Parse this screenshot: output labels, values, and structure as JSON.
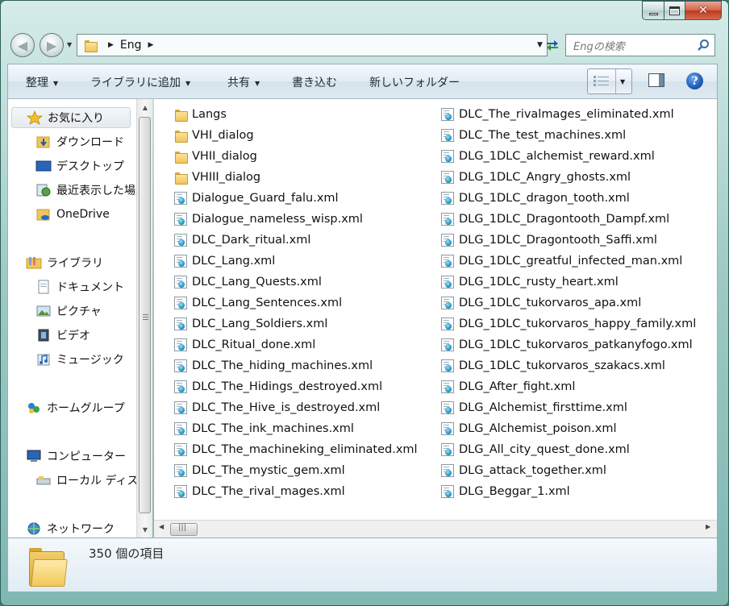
{
  "window": {
    "caption_buttons": {
      "minimize": "minimize",
      "maximize": "maximize",
      "close": "close"
    }
  },
  "address_bar": {
    "crumbs": [
      "Eng"
    ],
    "search_placeholder": "Engの検索"
  },
  "toolbar": {
    "organize": "整理",
    "add_to_library": "ライブラリに追加",
    "share": "共有",
    "burn": "書き込む",
    "new_folder": "新しいフォルダー"
  },
  "nav_pane": {
    "favorites": "お気に入り",
    "downloads": "ダウンロード",
    "desktop": "デスクトップ",
    "recent": "最近表示した場所",
    "onedrive": "OneDrive",
    "libraries": "ライブラリ",
    "documents": "ドキュメント",
    "pictures": "ピクチャ",
    "videos": "ビデオ",
    "music": "ミュージック",
    "homegroup": "ホームグループ",
    "computer": "コンピューター",
    "local_disk": "ローカル ディスク",
    "network": "ネットワーク"
  },
  "files": {
    "column1": [
      {
        "name": "Langs",
        "type": "folder"
      },
      {
        "name": "VHI_dialog",
        "type": "folder"
      },
      {
        "name": "VHII_dialog",
        "type": "folder"
      },
      {
        "name": "VHIII_dialog",
        "type": "folder"
      },
      {
        "name": "Dialogue_Guard_falu.xml",
        "type": "xml"
      },
      {
        "name": "Dialogue_nameless_wisp.xml",
        "type": "xml"
      },
      {
        "name": "DLC_Dark_ritual.xml",
        "type": "xml"
      },
      {
        "name": "DLC_Lang.xml",
        "type": "xml"
      },
      {
        "name": "DLC_Lang_Quests.xml",
        "type": "xml"
      },
      {
        "name": "DLC_Lang_Sentences.xml",
        "type": "xml"
      },
      {
        "name": "DLC_Lang_Soldiers.xml",
        "type": "xml"
      },
      {
        "name": "DLC_Ritual_done.xml",
        "type": "xml"
      },
      {
        "name": "DLC_The_hiding_machines.xml",
        "type": "xml"
      },
      {
        "name": "DLC_The_Hidings_destroyed.xml",
        "type": "xml"
      },
      {
        "name": "DLC_The_Hive_is_destroyed.xml",
        "type": "xml"
      },
      {
        "name": "DLC_The_ink_machines.xml",
        "type": "xml"
      },
      {
        "name": "DLC_The_machineking_eliminated.xml",
        "type": "xml"
      },
      {
        "name": "DLC_The_mystic_gem.xml",
        "type": "xml"
      },
      {
        "name": "DLC_The_rival_mages.xml",
        "type": "xml"
      }
    ],
    "column2": [
      {
        "name": "DLC_The_rivalmages_eliminated.xml",
        "type": "xml"
      },
      {
        "name": "DLC_The_test_machines.xml",
        "type": "xml"
      },
      {
        "name": "DLG_1DLC_alchemist_reward.xml",
        "type": "xml"
      },
      {
        "name": "DLG_1DLC_Angry_ghosts.xml",
        "type": "xml"
      },
      {
        "name": "DLG_1DLC_dragon_tooth.xml",
        "type": "xml"
      },
      {
        "name": "DLG_1DLC_Dragontooth_Dampf.xml",
        "type": "xml"
      },
      {
        "name": "DLG_1DLC_Dragontooth_Saffi.xml",
        "type": "xml"
      },
      {
        "name": "DLG_1DLC_greatful_infected_man.xml",
        "type": "xml"
      },
      {
        "name": "DLG_1DLC_rusty_heart.xml",
        "type": "xml"
      },
      {
        "name": "DLG_1DLC_tukorvaros_apa.xml",
        "type": "xml"
      },
      {
        "name": "DLG_1DLC_tukorvaros_happy_family.xml",
        "type": "xml"
      },
      {
        "name": "DLG_1DLC_tukorvaros_patkanyfogo.xml",
        "type": "xml"
      },
      {
        "name": "DLG_1DLC_tukorvaros_szakacs.xml",
        "type": "xml"
      },
      {
        "name": "DLG_After_fight.xml",
        "type": "xml"
      },
      {
        "name": "DLG_Alchemist_firsttime.xml",
        "type": "xml"
      },
      {
        "name": "DLG_Alchemist_poison.xml",
        "type": "xml"
      },
      {
        "name": "DLG_All_city_quest_done.xml",
        "type": "xml"
      },
      {
        "name": "DLG_attack_together.xml",
        "type": "xml"
      },
      {
        "name": "DLG_Beggar_1.xml",
        "type": "xml"
      }
    ]
  },
  "details": {
    "item_count": "350 個の項目"
  }
}
